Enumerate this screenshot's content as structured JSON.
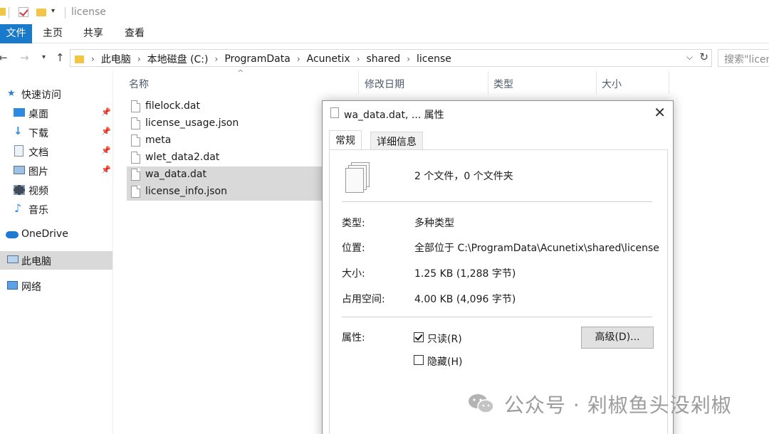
{
  "window": {
    "title": "license"
  },
  "ribbon": {
    "tabs": [
      "文件",
      "主页",
      "共享",
      "查看"
    ]
  },
  "address": {
    "path": [
      "此电脑",
      "本地磁盘 (C:)",
      "ProgramData",
      "Acunetix",
      "shared",
      "license"
    ],
    "search_placeholder": "搜索\"license\""
  },
  "nav": {
    "items": [
      {
        "label": "快速访问",
        "icon": "star-icon"
      },
      {
        "label": "桌面",
        "icon": "desktop-icon",
        "pinned": true
      },
      {
        "label": "下载",
        "icon": "download-icon",
        "pinned": true
      },
      {
        "label": "文档",
        "icon": "documents-icon",
        "pinned": true
      },
      {
        "label": "图片",
        "icon": "pictures-icon",
        "pinned": true
      },
      {
        "label": "视频",
        "icon": "videos-icon"
      },
      {
        "label": "音乐",
        "icon": "music-icon"
      },
      {
        "label": "OneDrive",
        "icon": "cloud-icon"
      },
      {
        "label": "此电脑",
        "icon": "computer-icon",
        "selected": true
      },
      {
        "label": "网络",
        "icon": "network-icon"
      }
    ]
  },
  "files": {
    "columns": [
      "名称",
      "修改日期",
      "类型",
      "大小"
    ],
    "rows": [
      {
        "name": "filelock.dat",
        "selected": false
      },
      {
        "name": "license_usage.json",
        "selected": false
      },
      {
        "name": "meta",
        "selected": false
      },
      {
        "name": "wlet_data2.dat",
        "selected": false
      },
      {
        "name": "wa_data.dat",
        "selected": true
      },
      {
        "name": "license_info.json",
        "selected": true
      }
    ]
  },
  "dialog": {
    "title": "wa_data.dat, ... 属性",
    "tabs": [
      "常规",
      "详细信息"
    ],
    "summary": "2 个文件，0 个文件夹",
    "props": [
      {
        "key": "类型:",
        "value": "多种类型"
      },
      {
        "key": "位置:",
        "value": "全部位于 C:\\ProgramData\\Acunetix\\shared\\license"
      },
      {
        "key": "大小:",
        "value": "1.25 KB (1,288 字节)"
      },
      {
        "key": "占用空间:",
        "value": "4.00 KB (4,096 字节)"
      }
    ],
    "attributes_label": "属性:",
    "readonly_label": "只读(R)",
    "readonly_checked": true,
    "hidden_label": "隐藏(H)",
    "hidden_checked": false,
    "advanced_button": "高级(D)..."
  },
  "watermark": {
    "text": "公众号 · 剁椒鱼头没剁椒"
  },
  "colors": {
    "accent": "#1979ca",
    "selection": "#d9d9d9",
    "folder": "#f3c545"
  }
}
